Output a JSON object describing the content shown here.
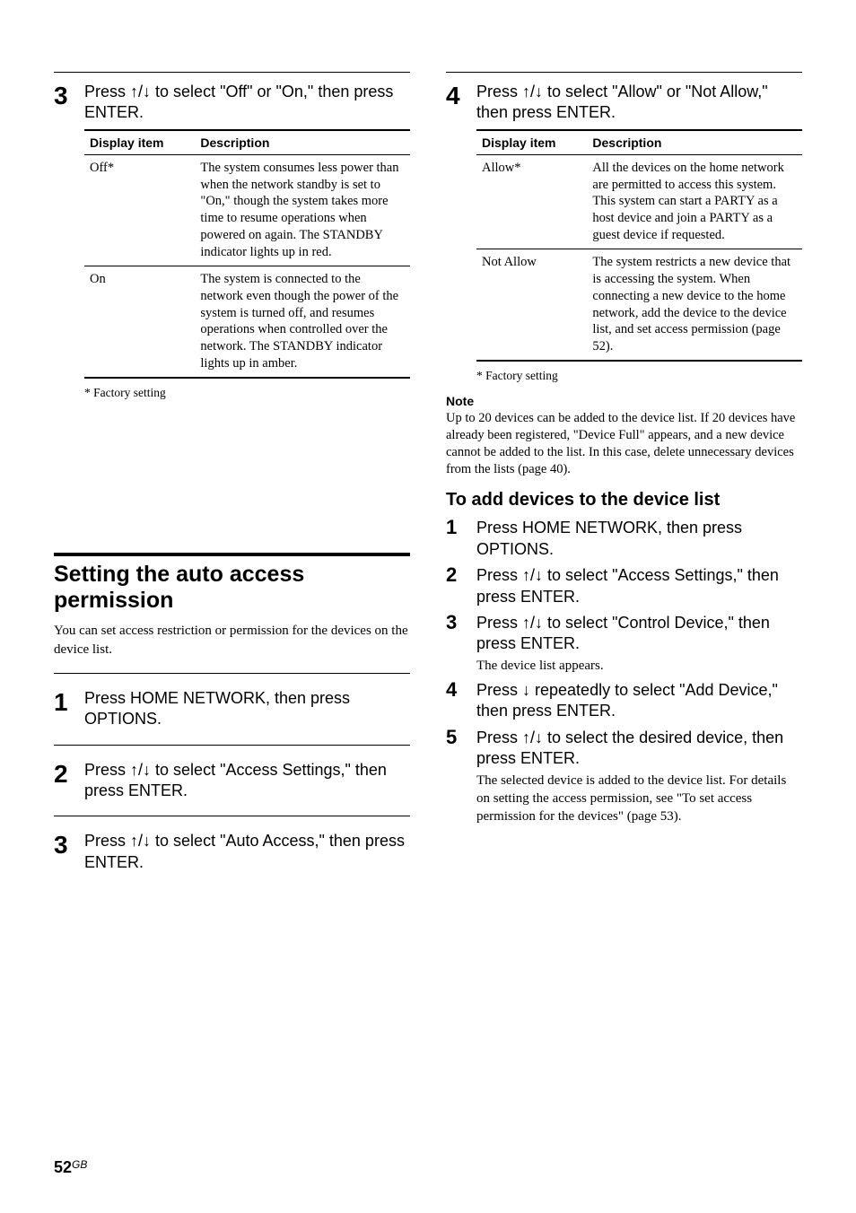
{
  "left": {
    "step3": {
      "num": "3",
      "text_parts": [
        "Press ",
        "↑",
        "/",
        "↓",
        " to select \"Off\" or \"On,\" then press ENTER."
      ],
      "table": {
        "head1": "Display item",
        "head2": "Description",
        "rows": [
          {
            "item": "Off*",
            "desc": "The system consumes less power than when the network standby is set to \"On,\" though the system takes more time to resume operations when powered on again. The STANDBY indicator lights up in red."
          },
          {
            "item": "On",
            "desc": "The system is connected to the network even though the power of the system is turned off, and resumes operations when controlled over the network. The STANDBY indicator lights up in amber."
          }
        ]
      },
      "foot": "*  Factory setting"
    },
    "section": {
      "title": "Setting the auto access permission",
      "intro": "You can set access restriction or permission for the devices on the device list.",
      "steps": {
        "s1": {
          "num": "1",
          "text": "Press HOME NETWORK, then press OPTIONS."
        },
        "s2": {
          "num": "2",
          "text_parts": [
            "Press ",
            "↑",
            "/",
            "↓",
            " to select \"Access Settings,\" then press ENTER."
          ]
        },
        "s3": {
          "num": "3",
          "text_parts": [
            "Press ",
            "↑",
            "/",
            "↓",
            " to select \"Auto Access,\" then press ENTER."
          ]
        }
      }
    }
  },
  "right": {
    "step4": {
      "num": "4",
      "text_parts": [
        "Press ",
        "↑",
        "/",
        "↓",
        " to select \"Allow\" or \"Not Allow,\" then press ENTER."
      ],
      "table": {
        "head1": "Display item",
        "head2": "Description",
        "rows": [
          {
            "item": "Allow*",
            "desc": "All the devices on the home network are permitted to access this system. This system can start a PARTY as a host device and join a PARTY as a guest device if requested."
          },
          {
            "item": "Not Allow",
            "desc": "The system restricts a new device that is accessing the system. When connecting a new device to the home network, add the device to the device list, and set access permission (page 52)."
          }
        ]
      },
      "foot": "*  Factory setting"
    },
    "note": {
      "label": "Note",
      "body": "Up to 20 devices can be added to the device list. If 20 devices have already been registered, \"Device Full\" appears, and a new device cannot be added to the list. In this case, delete unnecessary devices from the lists (page 40)."
    },
    "sub": {
      "title": "To add devices to the device list",
      "steps": {
        "s1": {
          "num": "1",
          "text": "Press HOME NETWORK, then press OPTIONS."
        },
        "s2": {
          "num": "2",
          "text_parts": [
            "Press ",
            "↑",
            "/",
            "↓",
            " to select \"Access Settings,\" then press ENTER."
          ]
        },
        "s3": {
          "num": "3",
          "text_parts": [
            "Press ",
            "↑",
            "/",
            "↓",
            " to select \"Control Device,\" then press ENTER."
          ],
          "sub": "The device list appears."
        },
        "s4": {
          "num": "4",
          "text_parts": [
            "Press ",
            "↓",
            " repeatedly to select \"Add Device,\" then press ENTER."
          ]
        },
        "s5": {
          "num": "5",
          "text_parts": [
            "Press ",
            "↑",
            "/",
            "↓",
            " to select the desired device, then press ENTER."
          ],
          "sub": "The selected device is added to the device list. For details on setting the access permission, see \"To set access permission for the devices\" (page 53)."
        }
      }
    }
  },
  "footer": {
    "page": "52",
    "gb": "GB"
  }
}
